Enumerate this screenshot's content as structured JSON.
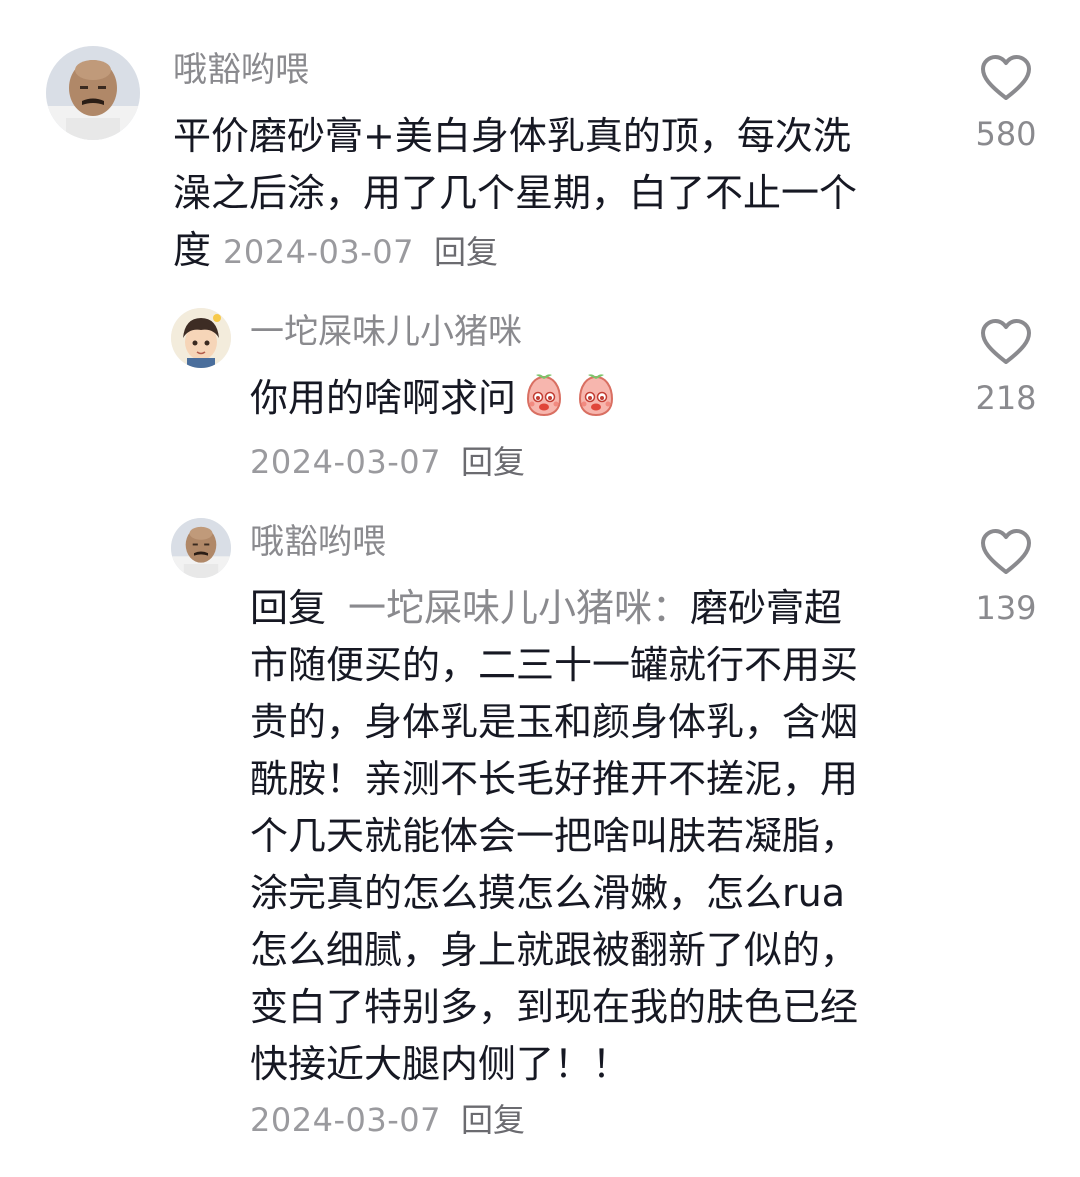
{
  "comments": [
    {
      "username": "哦豁哟喂",
      "lines": [
        "平价磨砂膏+美白身体乳真的顶，每次洗",
        "澡之后涂，用了几个星期，白了不止一个",
        "度"
      ],
      "date": "2024-03-07",
      "reply_label": "回复",
      "likes": "580"
    },
    {
      "username": "一坨屎味儿小猪咪",
      "text": "你用的啥啊求问",
      "date": "2024-03-07",
      "reply_label": "回复",
      "likes": "218"
    },
    {
      "username": "哦豁哟喂",
      "reply_prefix": "回复",
      "reply_target": "一坨屎味儿小猪咪：",
      "first_line_rest": "磨砂膏超",
      "lines": [
        "市随便买的，二三十一罐就行不用买",
        "贵的，身体乳是玉和颜身体乳，含烟",
        "酰胺！亲测不长毛好推开不搓泥，用",
        "个几天就能体会一把啥叫肤若凝脂，",
        "涂完真的怎么摸怎么滑嫩，怎么rua",
        "怎么细腻，身上就跟被翻新了似的，",
        "变白了特别多，到现在我的肤色已经",
        "快接近大腿内侧了！！"
      ],
      "date": "2024-03-07",
      "reply_label": "回复",
      "likes": "139"
    }
  ],
  "icons": {
    "like": "heart-outline-icon",
    "emoji": "pink-peach-face-emoji"
  },
  "colors": {
    "text": "#161823",
    "secondary": "#8a8a8e",
    "background": "#ffffff"
  }
}
